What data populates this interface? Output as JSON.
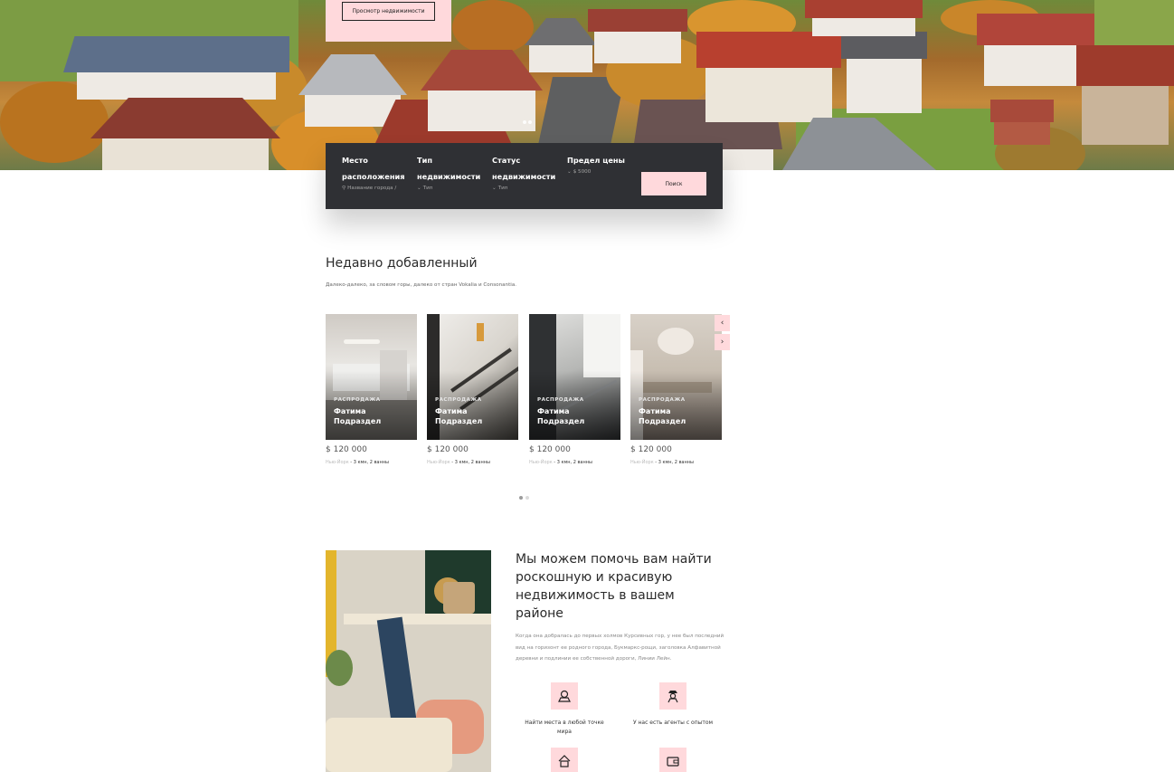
{
  "hero": {
    "promo_button": "Просмотр недвижимости"
  },
  "search": {
    "fields": [
      {
        "label_1": "Место",
        "label_2": "расположения",
        "value": "Название города / ",
        "icon": "search-icon"
      },
      {
        "label_1": "Тип",
        "label_2": "недвижимости",
        "value": "Тип",
        "icon": "chevron-down-icon"
      },
      {
        "label_1": "Статус",
        "label_2": "недвижимости",
        "value": "Тип",
        "icon": "chevron-down-icon"
      },
      {
        "label_1": "Предел цены",
        "label_2": "",
        "value": "$ 5000",
        "icon": "chevron-down-icon"
      }
    ],
    "button": "Поиск"
  },
  "recent": {
    "title": "Недавно добавленный",
    "subtitle": "Далеко-далеко, за словом горы, далеко от стран Vokalia и Consonantia.",
    "cards": [
      {
        "tag": "РАСПРОДАЖА",
        "name": "Фатима Подраздел",
        "price": "$ 120 000",
        "city": "Нью-Йорк",
        "details": " - 3 кмн, 2 ванны"
      },
      {
        "tag": "РАСПРОДАЖА",
        "name": "Фатима Подраздел",
        "price": "$ 120 000",
        "city": "Нью-Йорк",
        "details": " - 3 кмн, 2 ванны"
      },
      {
        "tag": "РАСПРОДАЖА",
        "name": "Фатима Подраздел",
        "price": "$ 120 000",
        "city": "Нью-Йорк",
        "details": " - 3 кмн, 2 ванны"
      },
      {
        "tag": "РАСПРОДАЖА",
        "name": "Фатима Подраздел",
        "price": "$ 120 000",
        "city": "Нью-Йорк",
        "details": " - 3 кмн, 2 ванны"
      }
    ],
    "prev_icon": "chevron-left-icon",
    "next_icon": "chevron-right-icon"
  },
  "about": {
    "title": "Мы можем помочь вам найти роскошную и красивую недвижимость в вашем районе",
    "text": "Когда она добралась до первых холмов Курсивных гор, у нее был последний вид на горизонт ее родного города, Букмаркс-рощи, заголовка Алфавитной деревни и подлинии ее собственной дороги, Линии Лейн.",
    "features": [
      {
        "caption": "Найти места в любой точке мира",
        "icon": "map-pin-icon"
      },
      {
        "caption": "У нас есть агенты с опытом",
        "icon": "agent-icon"
      },
      {
        "caption": "",
        "icon": "house-icon"
      },
      {
        "caption": "",
        "icon": "wallet-icon"
      }
    ]
  },
  "colors": {
    "accent_pink": "#ffd9dc",
    "search_bar": "#2f3034",
    "text_dark": "#2b2b2b"
  }
}
